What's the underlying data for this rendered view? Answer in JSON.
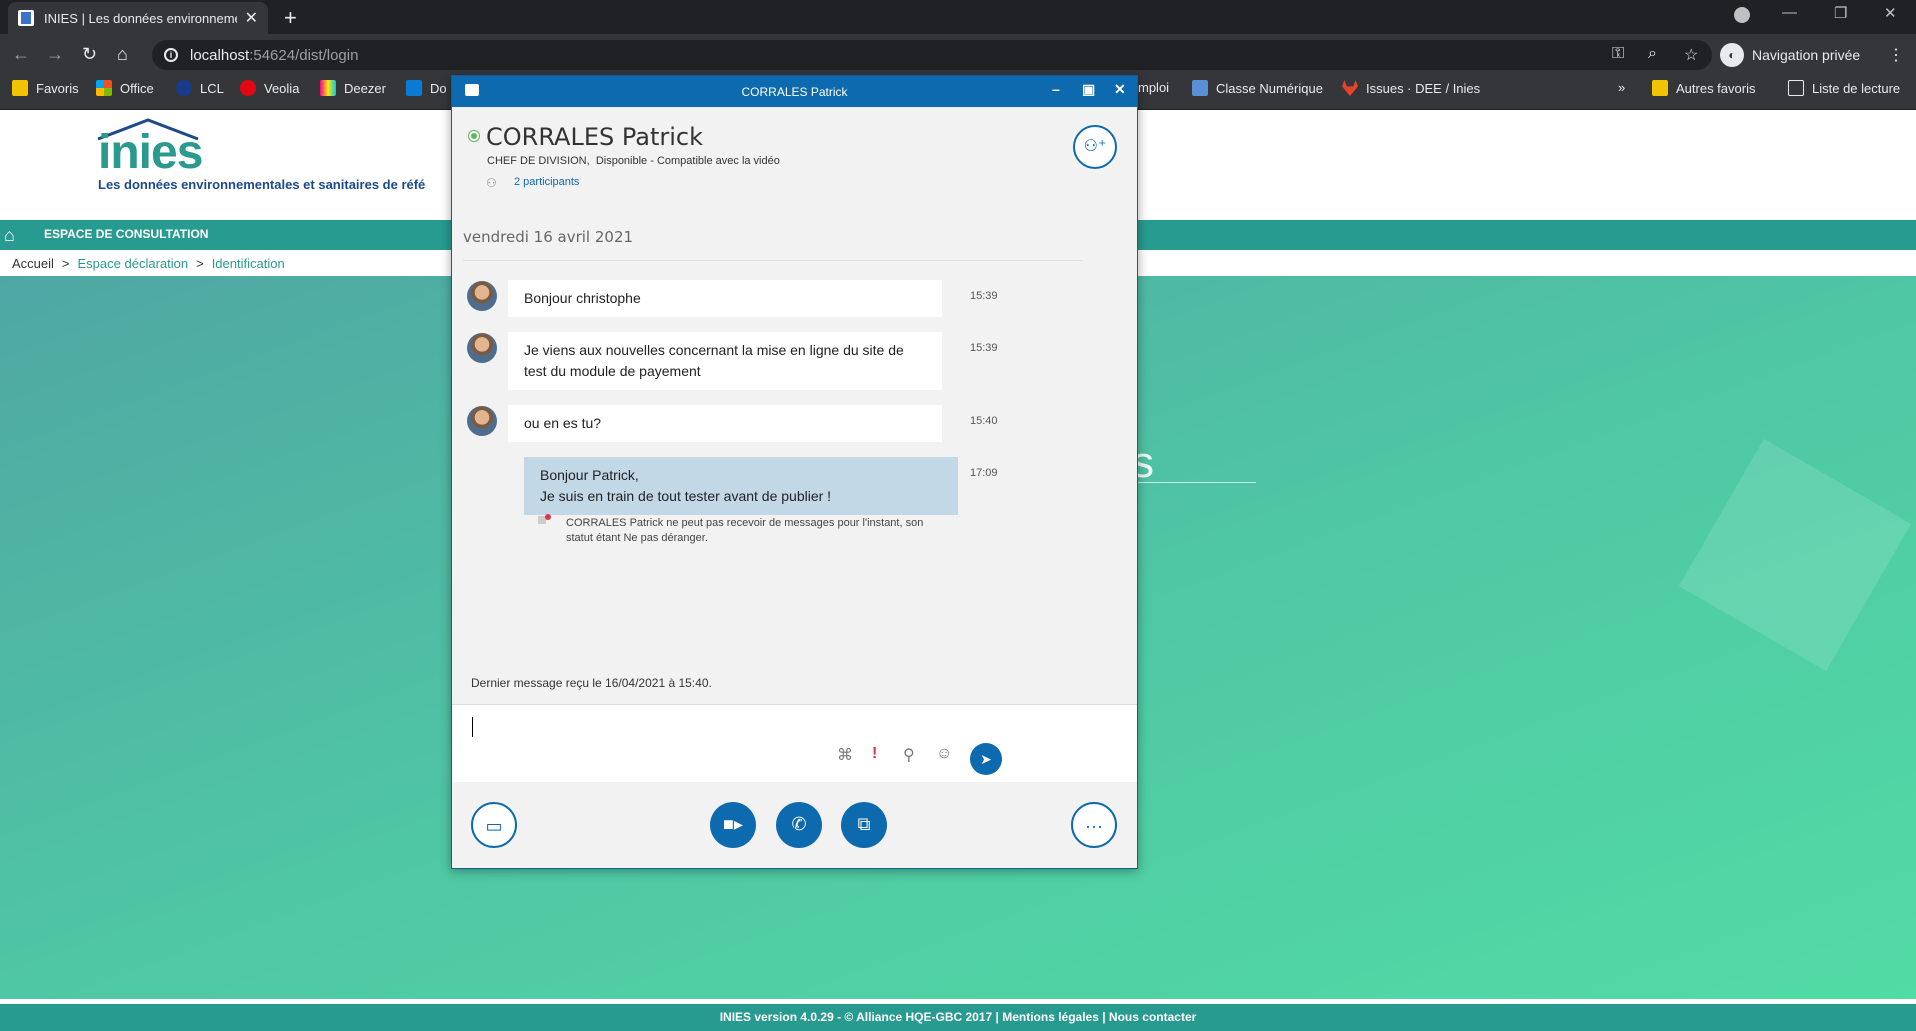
{
  "browser": {
    "tab_title": "INIES | Les données environneme",
    "tab_close": "✕",
    "new_tab": "+",
    "url_host": "localhost",
    "url_rest": ":54624/dist/login",
    "incognito_label": "Navigation privée",
    "bookmarks": [
      {
        "label": "Favoris",
        "color": "#f2c400"
      },
      {
        "label": "Office",
        "color": "#e74c1c"
      },
      {
        "label": "LCL",
        "color": "#1a3a8c"
      },
      {
        "label": "Veolia",
        "color": "#e30613"
      },
      {
        "label": "Deezer",
        "color": "#a238ff"
      },
      {
        "label": "Do",
        "color": "#0a7bd4"
      },
      {
        "label": "mploi",
        "color": ""
      },
      {
        "label": "Classe Numérique",
        "color": "#5a8fd8"
      },
      {
        "label": "Issues · DEE / Inies",
        "color": "#e24329"
      }
    ],
    "bookmarks_more": "»",
    "other_favorites": "Autres favoris",
    "reading_list": "Liste de lecture"
  },
  "page": {
    "logo": "inies",
    "tagline": "Les données environnementales et sanitaires de réfé",
    "nav_label": "ESPACE DE CONSULTATION",
    "breadcrumb": [
      "Accueil",
      "Espace déclaration",
      "Identification"
    ],
    "breadcrumb_sep": ">",
    "hero_fragment": "s",
    "footer": "INIES version 4.0.29 - © Alliance HQE-GBC 2017 | Mentions légales | Nous contacter",
    "accent_color": "#289b90"
  },
  "chat": {
    "window_title": "CORRALES Patrick",
    "contact_name": "CORRALES Patrick",
    "contact_title": "CHEF DE DIVISION,",
    "contact_status": "Disponible - Compatible avec la vidéo",
    "participants": "2 participants",
    "date_separator": "vendredi 16 avril 2021",
    "messages": [
      {
        "from": "contact",
        "text": "Bonjour christophe",
        "time": "15:39"
      },
      {
        "from": "contact",
        "text": "Je viens aux nouvelles concernant la mise en ligne du site de test du module de payement",
        "time": "15:39"
      },
      {
        "from": "contact",
        "text": "ou en es tu?",
        "time": "15:40"
      },
      {
        "from": "me",
        "line1": "Bonjour Patrick,",
        "line2": "Je suis en train de tout tester avant de publier !",
        "time": "17:09"
      }
    ],
    "delivery_error": "CORRALES Patrick ne peut pas recevoir de messages pour l'instant, son statut étant Ne pas déranger.",
    "last_received": "Dernier message reçu le 16/04/2021 à 15:40.",
    "brand_color": "#0e6aae"
  }
}
